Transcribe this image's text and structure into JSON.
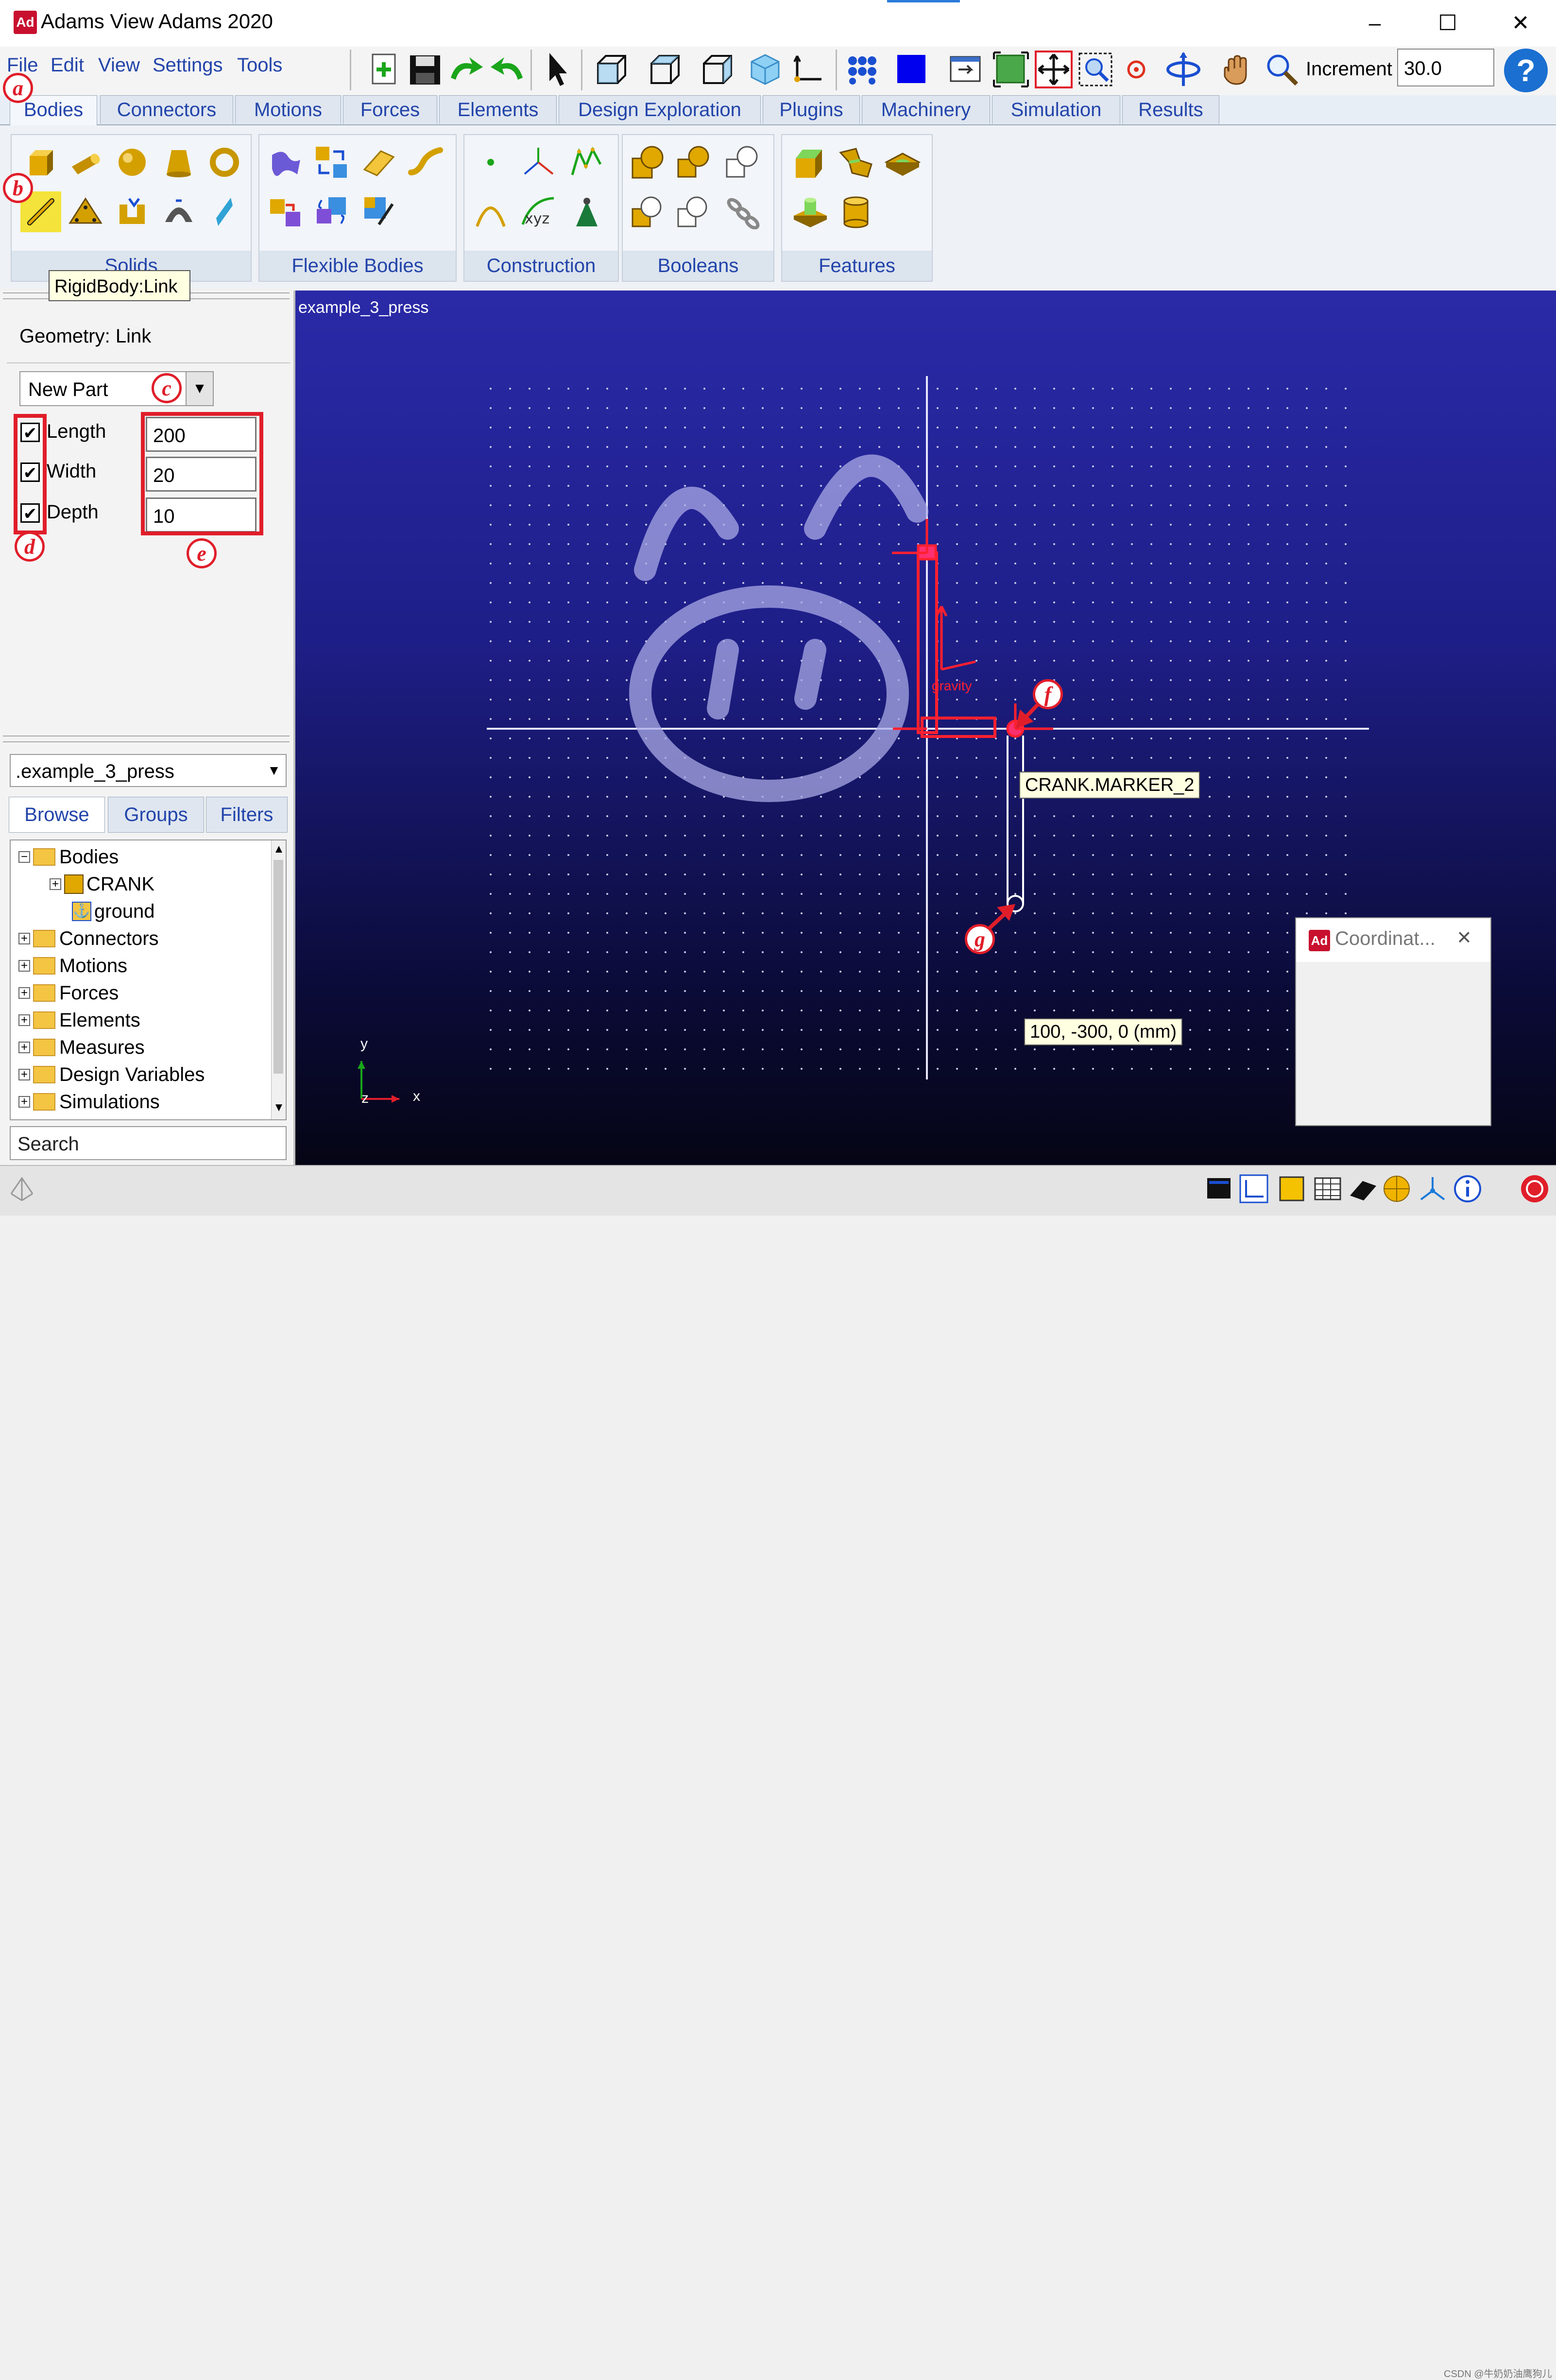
{
  "window": {
    "title": "Adams View Adams 2020",
    "logo_text": "Ad"
  },
  "menu": [
    "File",
    "Edit",
    "View",
    "Settings",
    "Tools"
  ],
  "toolbar": {
    "increment_label": "Increment",
    "increment_value": "30.0",
    "help_text": "?"
  },
  "tabs": [
    "Bodies",
    "Connectors",
    "Motions",
    "Forces",
    "Elements",
    "Design Exploration",
    "Plugins",
    "Machinery",
    "Simulation",
    "Results"
  ],
  "active_tab": "Bodies",
  "ribbon": {
    "groups": [
      "Solids",
      "Flexible Bodies",
      "Construction",
      "Booleans",
      "Features"
    ]
  },
  "tooltip": "RigidBody:Link",
  "panel": {
    "geometry_title": "Geometry: Link",
    "part_option": "New Part",
    "length_label": "Length",
    "length_value": "200",
    "width_label": "Width",
    "width_value": "20",
    "depth_label": "Depth",
    "depth_value": "10"
  },
  "annotations": {
    "a": "a",
    "b": "b",
    "c": "c",
    "d": "d",
    "e": "e",
    "f": "f",
    "g": "g"
  },
  "browser": {
    "model": ".example_3_press",
    "tabs": [
      "Browse",
      "Groups",
      "Filters"
    ],
    "tree": [
      "Bodies",
      "CRANK",
      "ground",
      "Connectors",
      "Motions",
      "Forces",
      "Elements",
      "Measures",
      "Design Variables",
      "Simulations"
    ],
    "search": "Search"
  },
  "viewport": {
    "model_name": "example_3_press",
    "marker_label": "CRANK.MARKER_2",
    "coord_label": "100, -300, 0 (mm)",
    "gravity_label": "gravity",
    "axis_y": "y",
    "axis_z": "z",
    "axis_x": "x"
  },
  "dialog": {
    "title": "Coordinat...",
    "logo_text": "Ad",
    "close": "✕"
  },
  "watermark": "CSDN @牛奶奶油鹰狗儿",
  "colors": {
    "accent": "#2244aa",
    "annotation_red": "#e01e2a",
    "viewport_top": "#2a2aa8",
    "viewport_bottom": "#050515"
  }
}
